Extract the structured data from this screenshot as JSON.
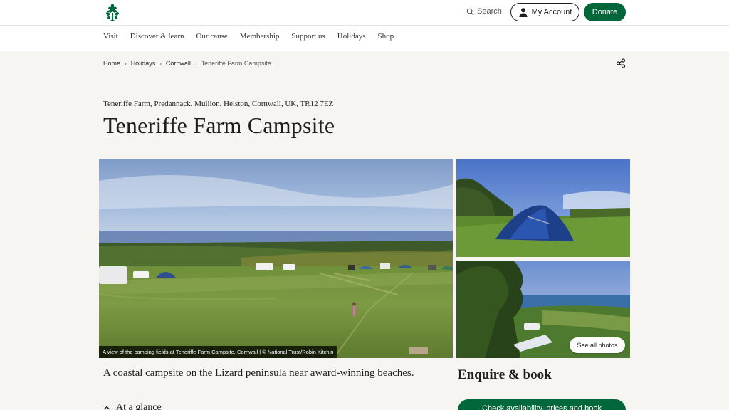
{
  "header": {
    "search_label": "Search",
    "account_label": "My Account",
    "donate_label": "Donate",
    "brand_color": "#00673a"
  },
  "nav": {
    "items": [
      "Visit",
      "Discover & learn",
      "Our cause",
      "Membership",
      "Support us",
      "Holidays",
      "Shop"
    ]
  },
  "breadcrumb": {
    "items": [
      "Home",
      "Holidays",
      "Cornwall"
    ],
    "current": "Teneriffe Farm Campsite",
    "separator": "›"
  },
  "page": {
    "address": "Teneriffe Farm, Predannack, Mullion, Helston, Cornwall, UK, TR12 7EZ",
    "title": "Teneriffe Farm Campsite",
    "summary": "A coastal campsite on the Lizard peninsula near award-winning beaches."
  },
  "gallery": {
    "caption": "A view of the camping fields at Teneriffe Farm Campsite, Cornwall | © National Trust/Robin Kitchin",
    "see_all_label": "See all photos"
  },
  "booking": {
    "heading": "Enquire & book",
    "button_label": "Check availability, prices and book"
  },
  "sections": {
    "glance_label": "At a glance"
  }
}
